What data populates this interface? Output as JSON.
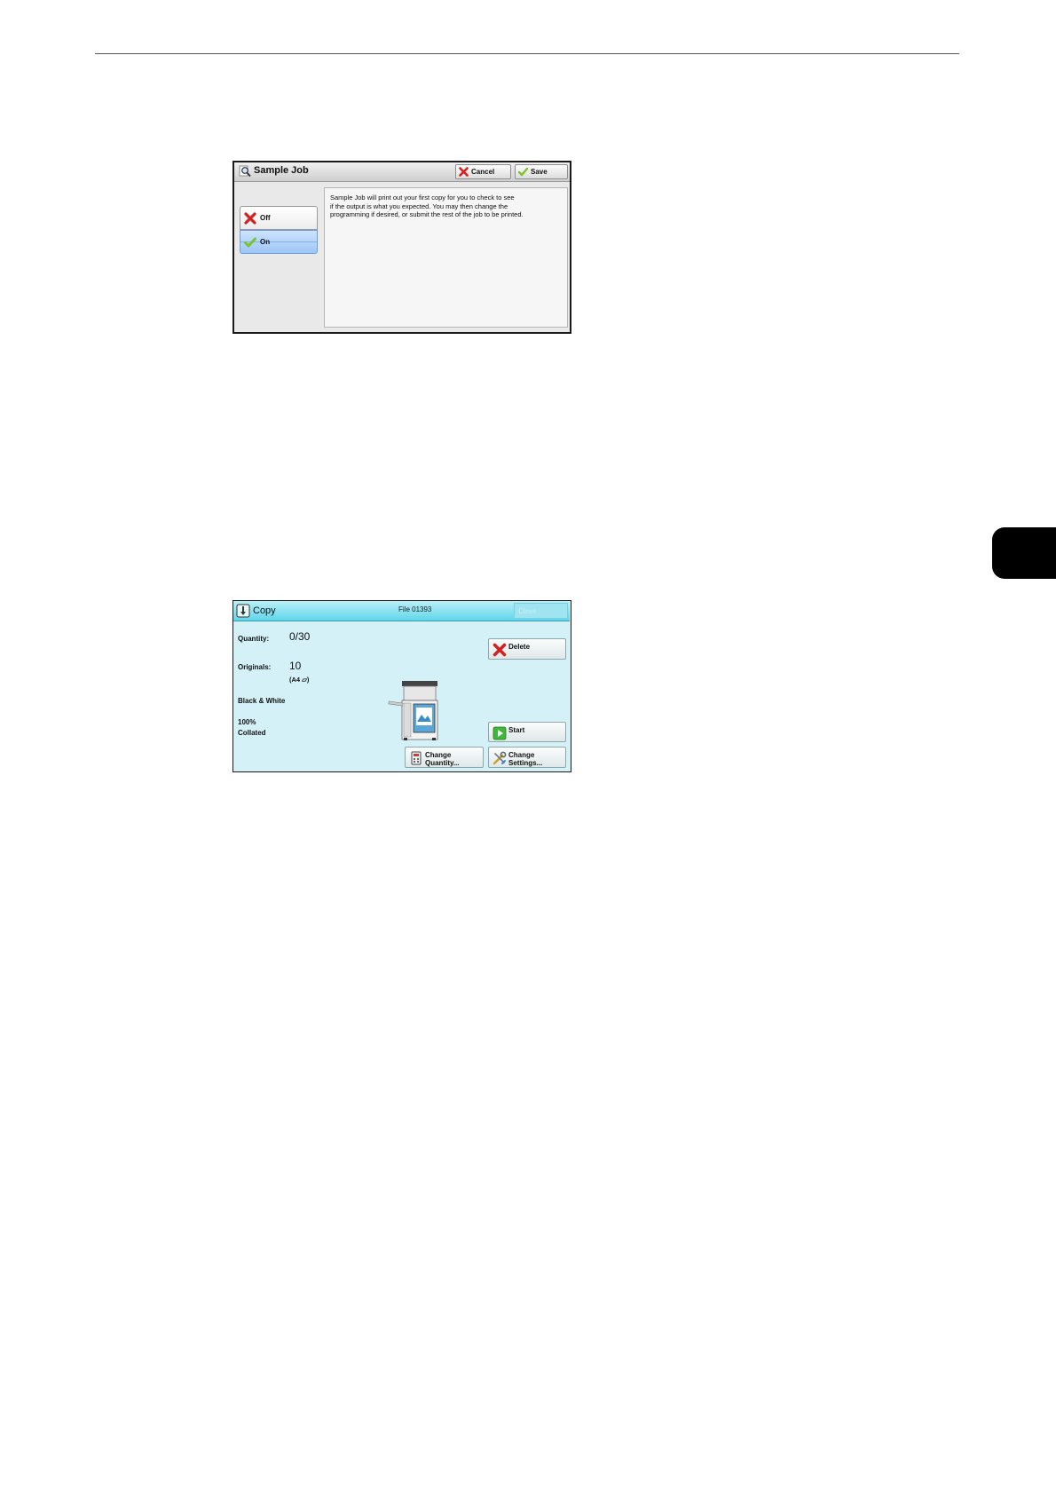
{
  "sample_job_panel": {
    "title": "Sample Job",
    "cancel_label": "Cancel",
    "save_label": "Save",
    "options": [
      {
        "label": "Off",
        "selected": false
      },
      {
        "label": "On",
        "selected": true
      }
    ],
    "description_lines": [
      "Sample Job will print out your first copy for you to check to see",
      "if the output is what you expected.  You may then change the",
      "programming if desired, or submit the rest of the job to be printed."
    ]
  },
  "copy_panel": {
    "title": "Copy",
    "file_label": "File 01393",
    "ghost_button_label": "Close",
    "quantity_label": "Quantity:",
    "quantity_value": "0/30",
    "originals_label": "Originals:",
    "originals_value": "10",
    "originals_size": "(A4 ▱)",
    "color_mode": "Black & White",
    "scale": "100%",
    "collation": "Collated",
    "delete_label": "Delete",
    "start_label": "Start",
    "change_quantity_label_1": "Change",
    "change_quantity_label_2": "Quantity...",
    "change_settings_label_1": "Change",
    "change_settings_label_2": "Settings..."
  },
  "colors": {
    "copy_panel_bg": "#d4f1f8",
    "copy_titlebar": "#5fd6ea",
    "selected_option": "#9ec6f6",
    "cancel_icon": "#d42020",
    "check_icon": "#7cc22a"
  },
  "icons": [
    "magnifier-icon",
    "cancel-x-icon",
    "save-check-icon",
    "off-x-icon",
    "on-check-icon",
    "copy-job-icon",
    "delete-x-icon",
    "start-play-icon",
    "quantity-icon",
    "settings-tools-icon",
    "printer-icon"
  ]
}
